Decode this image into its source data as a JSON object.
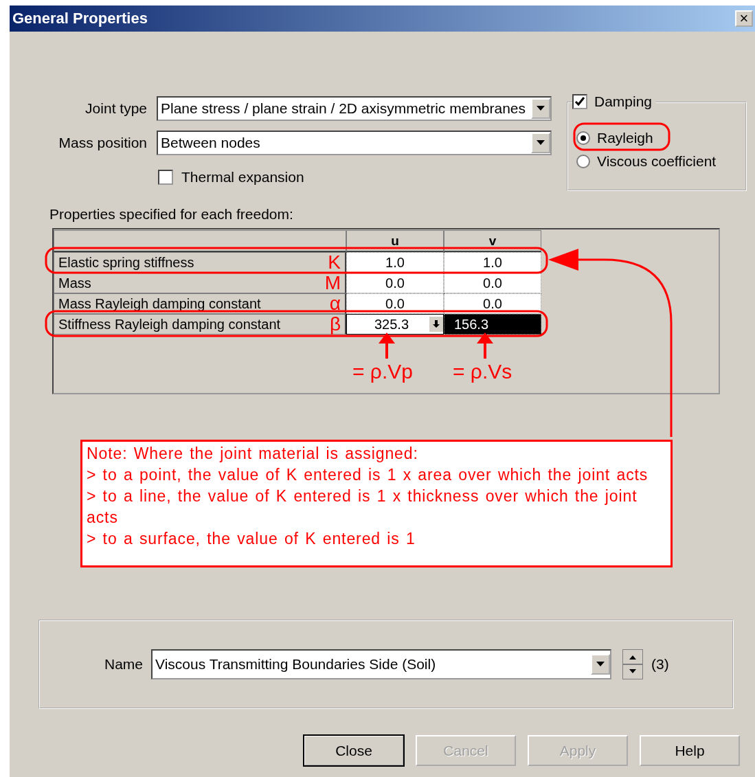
{
  "window": {
    "title": "General Properties",
    "close": "×"
  },
  "joint_type": {
    "label": "Joint type",
    "value": "Plane stress / plane strain / 2D axisymmetric membranes"
  },
  "mass_position": {
    "label": "Mass position",
    "value": "Between nodes"
  },
  "thermal_expansion": {
    "label": "Thermal expansion",
    "checked": false
  },
  "damping": {
    "label": "Damping",
    "checked": true,
    "options": [
      {
        "label": "Rayleigh",
        "selected": true,
        "circled": true
      },
      {
        "label": "Viscous coefficient",
        "selected": false,
        "circled": false
      }
    ]
  },
  "grid": {
    "caption": "Properties specified for each freedom:",
    "columns": [
      "u",
      "v"
    ],
    "rows": [
      {
        "label": "Elastic spring stiffness",
        "symbol": "K",
        "circled": true,
        "cells": [
          {
            "value": "1.0",
            "selected": false,
            "kind": "text"
          },
          {
            "value": "1.0",
            "selected": false,
            "kind": "text"
          }
        ]
      },
      {
        "label": "Mass",
        "symbol": "M",
        "circled": false,
        "cells": [
          {
            "value": "0.0",
            "selected": false,
            "kind": "text"
          },
          {
            "value": "0.0",
            "selected": false,
            "kind": "text"
          }
        ]
      },
      {
        "label": "Mass Rayleigh damping constant",
        "symbol": "α",
        "circled": false,
        "cells": [
          {
            "value": "0.0",
            "selected": false,
            "kind": "text"
          },
          {
            "value": "0.0",
            "selected": false,
            "kind": "text"
          }
        ]
      },
      {
        "label": "Stiffness Rayleigh damping constant",
        "symbol": "β",
        "circled": true,
        "cells": [
          {
            "value": "325.3",
            "selected": false,
            "kind": "dropdown"
          },
          {
            "value": "156.3",
            "selected": true,
            "kind": "text"
          }
        ]
      }
    ],
    "formulas": [
      "= ρ.Vp",
      "= ρ.Vs"
    ]
  },
  "note": {
    "lines": [
      "Note:  Where the joint material is assigned:",
      "> to a point, the value of K entered is 1 x area over which the joint acts",
      "> to a line, the value of K entered is 1 x thickness over which the joint acts",
      "> to a surface, the value of K entered is 1"
    ]
  },
  "name": {
    "label": "Name",
    "value": "Viscous Transmitting Boundaries Side (Soil)",
    "count": "(3)"
  },
  "buttons": [
    {
      "label": "Close",
      "disabled": false,
      "default": true
    },
    {
      "label": "Cancel",
      "disabled": true,
      "default": false
    },
    {
      "label": "Apply",
      "disabled": true,
      "default": false
    },
    {
      "label": "Help",
      "disabled": false,
      "default": false
    }
  ]
}
